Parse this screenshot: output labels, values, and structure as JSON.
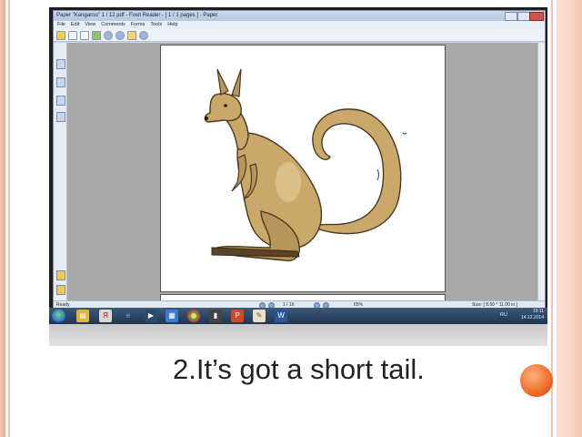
{
  "window": {
    "title": "Paper \"Kangaroo\" 1 / 12 pdf - Foxit Reader - [ 1 / 1 pages ] - Paper",
    "menu": [
      "File",
      "Edit",
      "View",
      "Comments",
      "Forms",
      "Tools",
      "Help"
    ]
  },
  "status": {
    "ready": "Ready",
    "page": "1 / 16",
    "zoom": "65%",
    "size": "Size: [ 8.50 * 11.00 in ]"
  },
  "taskbar": {
    "language": "RU",
    "time": "19:11",
    "date": "14.12.2014"
  },
  "caption": "2.It’s got a short tail.",
  "colors": {
    "kangaroo_body": "#c9a86a",
    "kangaroo_shadow": "#a9854a",
    "kangaroo_outline": "#4a3a22",
    "accent_orb": "#f06a2a"
  }
}
